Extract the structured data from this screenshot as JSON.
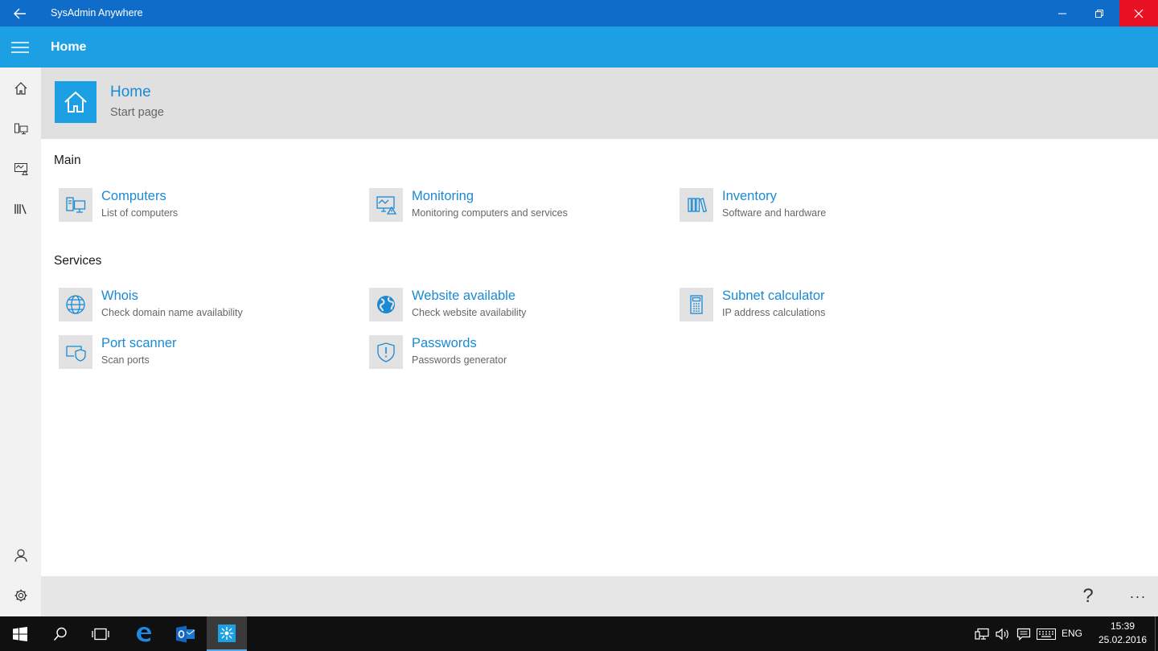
{
  "window": {
    "title": "SysAdmin Anywhere",
    "back_icon": "back-arrow-icon",
    "controls": [
      "minimize-icon",
      "restore-icon",
      "close-icon"
    ]
  },
  "appbar": {
    "title": "Home",
    "menu_icon": "hamburger-icon"
  },
  "rail": {
    "top_items": [
      "home-icon",
      "computers-icon",
      "monitoring-icon",
      "inventory-icon"
    ],
    "bottom_items": [
      "user-icon",
      "settings-icon"
    ]
  },
  "hero": {
    "title": "Home",
    "subtitle": "Start page",
    "icon": "home-icon"
  },
  "sections": [
    {
      "title": "Main",
      "items": [
        {
          "label": "Computers",
          "desc": "List of computers",
          "icon": "computers-icon"
        },
        {
          "label": "Monitoring",
          "desc": "Monitoring computers and services",
          "icon": "monitoring-icon"
        },
        {
          "label": "Inventory",
          "desc": "Software and hardware",
          "icon": "inventory-icon"
        }
      ]
    },
    {
      "title": "Services",
      "items": [
        {
          "label": "Whois",
          "desc": "Check domain name availability",
          "icon": "globe-icon"
        },
        {
          "label": "Website available",
          "desc": "Check website availability",
          "icon": "world-icon"
        },
        {
          "label": "Subnet calculator",
          "desc": "IP address calculations",
          "icon": "calculator-icon"
        },
        {
          "label": "Port scanner",
          "desc": "Scan ports",
          "icon": "port-shield-icon"
        },
        {
          "label": "Passwords",
          "desc": "Passwords generator",
          "icon": "shield-alert-icon"
        }
      ]
    }
  ],
  "cmdbar": {
    "help": "?",
    "more": "···"
  },
  "taskbar": {
    "buttons": [
      "windows-start-icon",
      "search-icon",
      "task-view-icon",
      "edge-icon",
      "outlook-icon",
      "sysadmin-app-icon"
    ],
    "tray": [
      "network-icon",
      "volume-icon",
      "notifications-icon",
      "keyboard-icon"
    ],
    "language": "ENG",
    "time": "15:39",
    "date": "25.02.2016"
  },
  "colors": {
    "titlebar": "#0f6cc9",
    "accent": "#1ca0e3",
    "link": "#1a8ad4",
    "close": "#e81123"
  }
}
